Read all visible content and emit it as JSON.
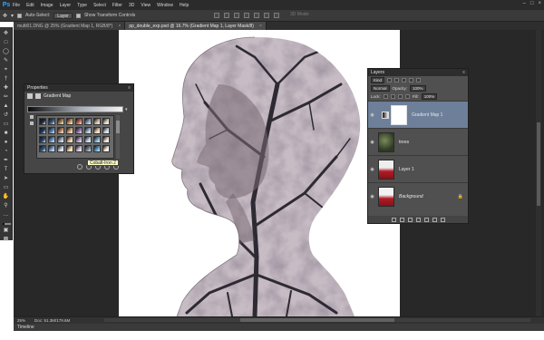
{
  "app": {
    "logo": "Ps"
  },
  "menu": [
    "File",
    "Edit",
    "Image",
    "Layer",
    "Type",
    "Select",
    "Filter",
    "3D",
    "View",
    "Window",
    "Help"
  ],
  "options": {
    "auto_select_label": "Auto-Select:",
    "auto_select_value": "Layer",
    "transform_label": "Show Transform Controls",
    "mode_3d": "3D Mode:"
  },
  "tabs": [
    {
      "label": "multi01.DNG @ 25% (Gradient Map 1, RGB/8*)",
      "active": false
    },
    {
      "label": "pp_double_exp.psd @ 16.7% (Gradient Map 1, Layer Mask/8)",
      "active": true
    }
  ],
  "properties": {
    "title": "Properties",
    "subtitle": "Gradient Map",
    "tooltip": "Cobalt-Iron 2"
  },
  "layers_panel": {
    "title": "Layers",
    "kind": "Kind",
    "blend_mode": "Normal",
    "opacity_label": "Opacity:",
    "opacity": "100%",
    "lock_label": "Lock:",
    "fill_label": "Fill:",
    "fill": "100%",
    "layers": [
      {
        "name": "Gradient Map 1",
        "selected": true,
        "type": "adjustment",
        "italic": false
      },
      {
        "name": "trees",
        "selected": false,
        "type": "trees",
        "italic": false
      },
      {
        "name": "Layer 1",
        "selected": false,
        "type": "portrait",
        "italic": false
      },
      {
        "name": "Background",
        "selected": false,
        "type": "portrait",
        "italic": true,
        "locked": true
      }
    ]
  },
  "status": {
    "zoom": "25%",
    "doc": "Doc: 51.3M/179.6M"
  },
  "timeline": "Timeline",
  "gradient_presets": [
    "#1c2a40",
    "#3a5f8a",
    "#b08a5a",
    "#d4a06a",
    "#c86f5a",
    "#8fa6c4",
    "#d9c0a8",
    "#e0d6c4",
    "#1f3c5c",
    "#5e86b5",
    "#c49672",
    "#e2b186",
    "#9a7bb0",
    "#a8c0da",
    "#f0d2b4",
    "#cfd8e0",
    "#26486a",
    "#6f9ad0",
    "#a5b8c9",
    "#e7c49a",
    "#b8a0c8",
    "#bcd0e4",
    "#7fb6d8",
    "#e8e0d0",
    "#2f5a80",
    "#86aee0",
    "#ced7e0",
    "#f2d6b0",
    "#d6c4de",
    "#7a8898",
    "#62a3cc",
    "#f3eee4"
  ]
}
